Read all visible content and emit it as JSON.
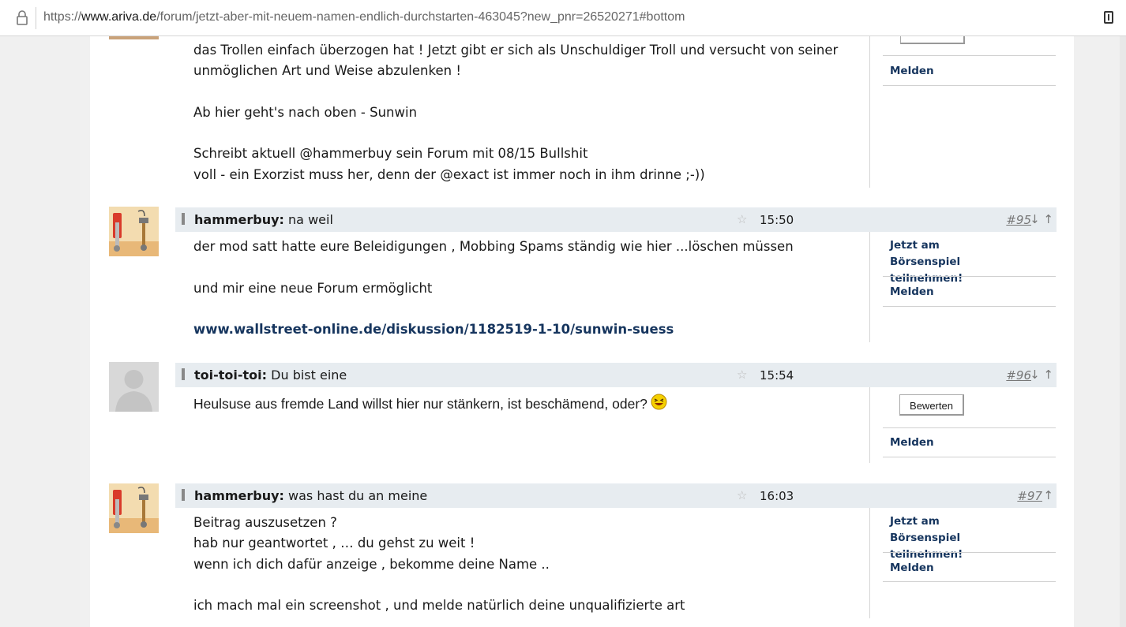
{
  "browser": {
    "url_prefix": "https://",
    "url_host": "www.ariva.de",
    "url_path": "/forum/jetzt-aber-mit-neuem-namen-endlich-durchstarten-463045?new_pnr=26520271#bottom"
  },
  "post94_tail": {
    "text": "das Trollen einfach überzogen hat ! Jetzt gibt er sich als Unschuldiger Troll und versucht von seiner\nunmöglichen Art und Weise abzulenken !\n\nAb hier geht's nach oben - Sunwin\n\nSchreibt aktuell @hammerbuy sein Forum mit 08/15 Bullshit\nvoll - ein Exorzist muss her, denn der @exact ist immer noch in ihm drinne ;-))",
    "melden": "Melden"
  },
  "post95": {
    "user": "hammerbuy:",
    "title": " na weil",
    "time": "15:50",
    "number": "#95",
    "arrows": "↓ ↑",
    "text": "der mod satt hatte eure Beleidigungen , Mobbing Spams ständig wie hier ...löschen müssen\n\nund mir eine neue Forum ermöglicht",
    "link": "www.wallstreet-online.de/diskussion/1182519-1-10/sunwin-suess",
    "side_link": "Jetzt am Börsenspiel teilnehmen!",
    "melden": "Melden"
  },
  "post96": {
    "user": "toi-toi-toi:",
    "title": " Du bist eine",
    "time": "15:54",
    "number": "#96",
    "arrows": "↓ ↑",
    "text": "Heulsuse aus fremde Land willst hier nur stänkern, ist beschämend, oder?",
    "rate_button": "Bewerten",
    "melden": "Melden"
  },
  "post97": {
    "user": "hammerbuy:",
    "title": " was hast du an meine",
    "time": "16:03",
    "number": "#97",
    "arrows": "↑",
    "text": "Beitrag auszusetzen ?\nhab nur geantwortet , … du gehst zu weit !\nwenn ich dich dafür anzeige , bekomme deine Name ..\n\nich mach mal ein screenshot , und melde natürlich deine unqualifizierte art",
    "side_link": "Jetzt am Börsenspiel teilnehmen!",
    "melden": "Melden"
  },
  "colors": {
    "link": "#16355e",
    "header_bg": "#e7ecf0",
    "page_bg": "#f0f0f0"
  }
}
